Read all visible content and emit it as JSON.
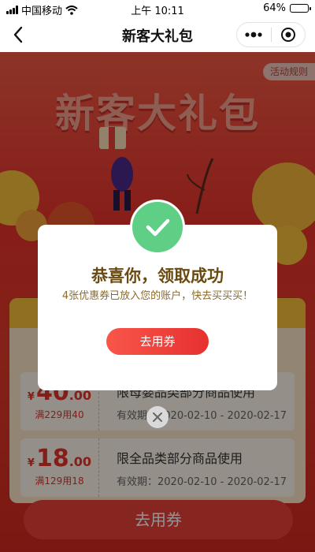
{
  "status_bar": {
    "carrier": "中国移动",
    "time": "上午 10:11",
    "battery_percent": "64%",
    "battery_level": 0.64
  },
  "nav": {
    "title": "新客大礼包"
  },
  "page": {
    "rules_label": "活动规则",
    "hero_title": "新客大礼包",
    "coupons": [
      {
        "yen": "¥",
        "amount_int": "40",
        "amount_dec": ".00",
        "condition": "满229用40",
        "description": "限母婴品类部分商品使用",
        "validity": "有效期：2020-02-10 - 2020-02-17"
      },
      {
        "yen": "¥",
        "amount_int": "18",
        "amount_dec": ".00",
        "condition": "满129用18",
        "description": "限全品类部分商品使用",
        "validity": "有效期：2020-02-10 - 2020-02-17"
      }
    ],
    "bottom_button": "去用券"
  },
  "modal": {
    "title": "恭喜你，领取成功",
    "subtitle": "4张优惠券已放入您的账户，快去买买买！",
    "button": "去用券"
  },
  "icons": {
    "back": "chevron-left-icon",
    "more": "more-dots-icon",
    "close_mini": "target-close-icon",
    "success": "checkmark-icon",
    "dismiss": "close-x-icon"
  },
  "colors": {
    "page_red": "#e8322b",
    "success_green": "#5fcf86",
    "button_red": "#e6312f",
    "title_brown": "#6b4a12"
  }
}
